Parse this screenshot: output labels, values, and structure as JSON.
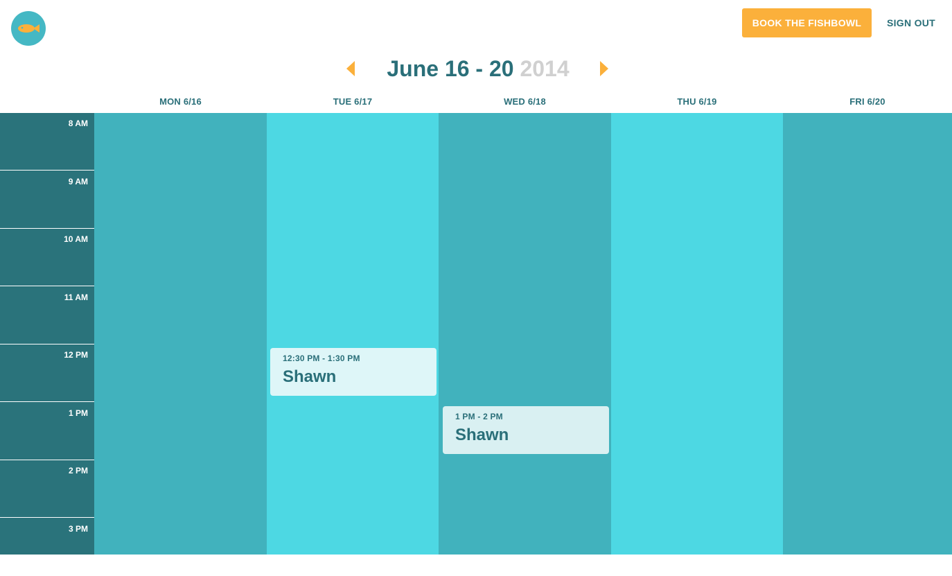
{
  "header": {
    "logo_icon": "fish-icon",
    "book_button_label": "BOOK THE FISHBOWL",
    "sign_out_label": "SIGN OUT"
  },
  "week_nav": {
    "prev_icon": "triangle-left-icon",
    "next_icon": "triangle-right-icon",
    "range_dates": "June 16 - 20",
    "range_year": "2014"
  },
  "days": [
    {
      "label": "MON 6/16"
    },
    {
      "label": "TUE 6/17"
    },
    {
      "label": "WED 6/18"
    },
    {
      "label": "THU 6/19"
    },
    {
      "label": "FRI 6/20"
    }
  ],
  "times": [
    "8 AM",
    "9 AM",
    "10 AM",
    "11 AM",
    "12 PM",
    "1 PM",
    "2 PM",
    "3 PM"
  ],
  "events": [
    {
      "day": "TUE 6/17",
      "time": "12:30 PM - 1:30 PM",
      "name": "Shawn"
    },
    {
      "day": "WED 6/18",
      "time": "1 PM - 2 PM",
      "name": "Shawn"
    }
  ],
  "colors": {
    "accent": "#fbb03b",
    "primary_text": "#2a6f79",
    "time_column": "#2a737b",
    "day_column_dark": "#41b2bd",
    "day_column_light": "#4dd8e3",
    "year_text": "#d0d0d0"
  }
}
